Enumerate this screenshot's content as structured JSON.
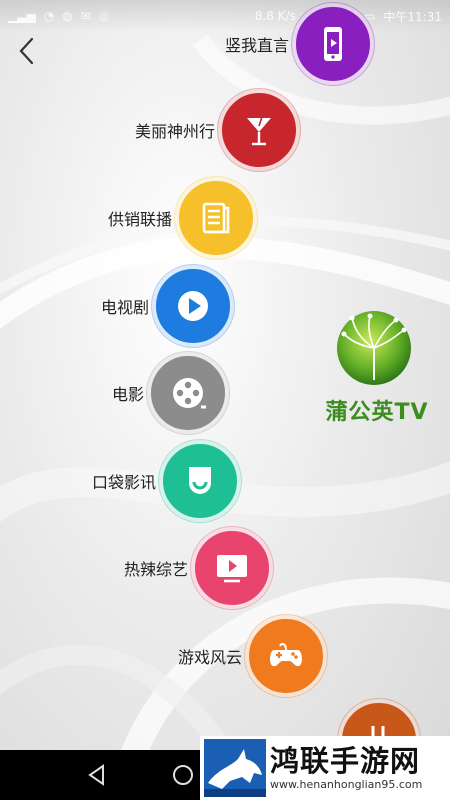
{
  "status_bar": {
    "speed": "8.8 K/s",
    "time": "中午11:31"
  },
  "menu": {
    "items": [
      {
        "label": "竖我直言",
        "icon": "phone-play-icon",
        "color": "#8a1fbf"
      },
      {
        "label": "美丽神州行",
        "icon": "cocktail-icon",
        "color": "#c7262c"
      },
      {
        "label": "供销联播",
        "icon": "document-icon",
        "color": "#f5c02a"
      },
      {
        "label": "电视剧",
        "icon": "play-icon",
        "color": "#1e7be0"
      },
      {
        "label": "电影",
        "icon": "film-reel-icon",
        "color": "#8c8c8c"
      },
      {
        "label": "口袋影讯",
        "icon": "pocket-icon",
        "color": "#1fbf96"
      },
      {
        "label": "热辣综艺",
        "icon": "tv-play-icon",
        "color": "#e8446e"
      },
      {
        "label": "游戏风云",
        "icon": "gamepad-icon",
        "color": "#f07a1e"
      },
      {
        "label": "",
        "icon": "partial-icon",
        "color": "#c8581a"
      }
    ]
  },
  "logo": {
    "text": "蒲公英TV",
    "color": "#3b8d1e"
  },
  "watermark": {
    "title": "鸿联手游网",
    "url": "www.henanhonglian95.com"
  }
}
